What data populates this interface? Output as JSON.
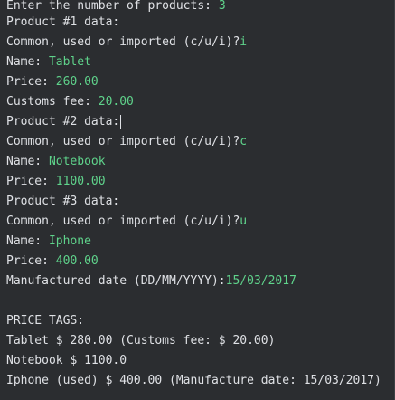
{
  "console": {
    "lines": [
      {
        "out": "Enter the number of products: ",
        "in": "3"
      },
      {
        "out": "Product #1 data:",
        "in": ""
      },
      {
        "out": "Common, used or imported (c/u/i)?",
        "in": "i"
      },
      {
        "out": "Name: ",
        "in": "Tablet"
      },
      {
        "out": "Price: ",
        "in": "260.00"
      },
      {
        "out": "Customs fee: ",
        "in": "20.00"
      },
      {
        "out": "Product #2 data:",
        "in": ""
      },
      {
        "out": "Common, used or imported (c/u/i)?",
        "in": "c"
      },
      {
        "out": "Name: ",
        "in": "Notebook"
      },
      {
        "out": "Price: ",
        "in": "1100.00"
      },
      {
        "out": "Product #3 data:",
        "in": ""
      },
      {
        "out": "Common, used or imported (c/u/i)?",
        "in": "u"
      },
      {
        "out": "Name: ",
        "in": "Iphone"
      },
      {
        "out": "Price: ",
        "in": "400.00"
      },
      {
        "out": "Manufactured date (DD/MM/YYYY):",
        "in": "15/03/2017"
      },
      {
        "out": "",
        "in": ""
      },
      {
        "out": "PRICE TAGS:",
        "in": ""
      },
      {
        "out": "Tablet $ 280.00 (Customs fee: $ 20.00)",
        "in": ""
      },
      {
        "out": "Notebook $ 1100.0",
        "in": ""
      },
      {
        "out": "Iphone (used) $ 400.00 (Manufacture date: 15/03/2017)",
        "in": ""
      }
    ]
  },
  "colors": {
    "background": "#2b2d30",
    "output_text": "#dfe1e5",
    "user_input_text": "#5fd38b"
  }
}
